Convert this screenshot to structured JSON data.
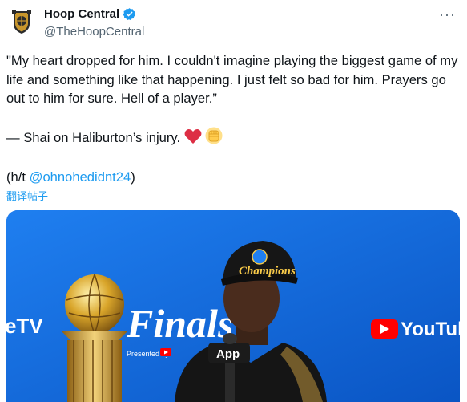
{
  "account": {
    "display_name": "Hoop Central",
    "handle": "@TheHoopCentral",
    "verified": true,
    "avatar_icon": "hoop-central-logo"
  },
  "menu": {
    "more_icon": "more-horizontal-icon",
    "label": "···"
  },
  "tweet": {
    "quote": "\"My heart dropped for him. I couldn't imagine playing the biggest game of my life and something like that happening. I just felt so bad for him. Prayers go out to him for sure. Hell of a player.”",
    "attribution": "— Shai on Haliburton’s injury.",
    "hat_tip_prefix": "(h/t ",
    "hat_tip_mention": "@ohnohedidnt24",
    "hat_tip_suffix": ")",
    "translate_label": "翻译帖子"
  },
  "media": {
    "backdrop_word": "Finals",
    "backdrop_sub": "Presented by",
    "left_brand": "eTV",
    "right_brand": "YouTube",
    "cap_text": "Champions",
    "mic_text": "App"
  },
  "colors": {
    "accent": "#1d9bf0",
    "text": "#0f1419",
    "muted": "#536471",
    "backdrop": "#0a5fd6"
  }
}
